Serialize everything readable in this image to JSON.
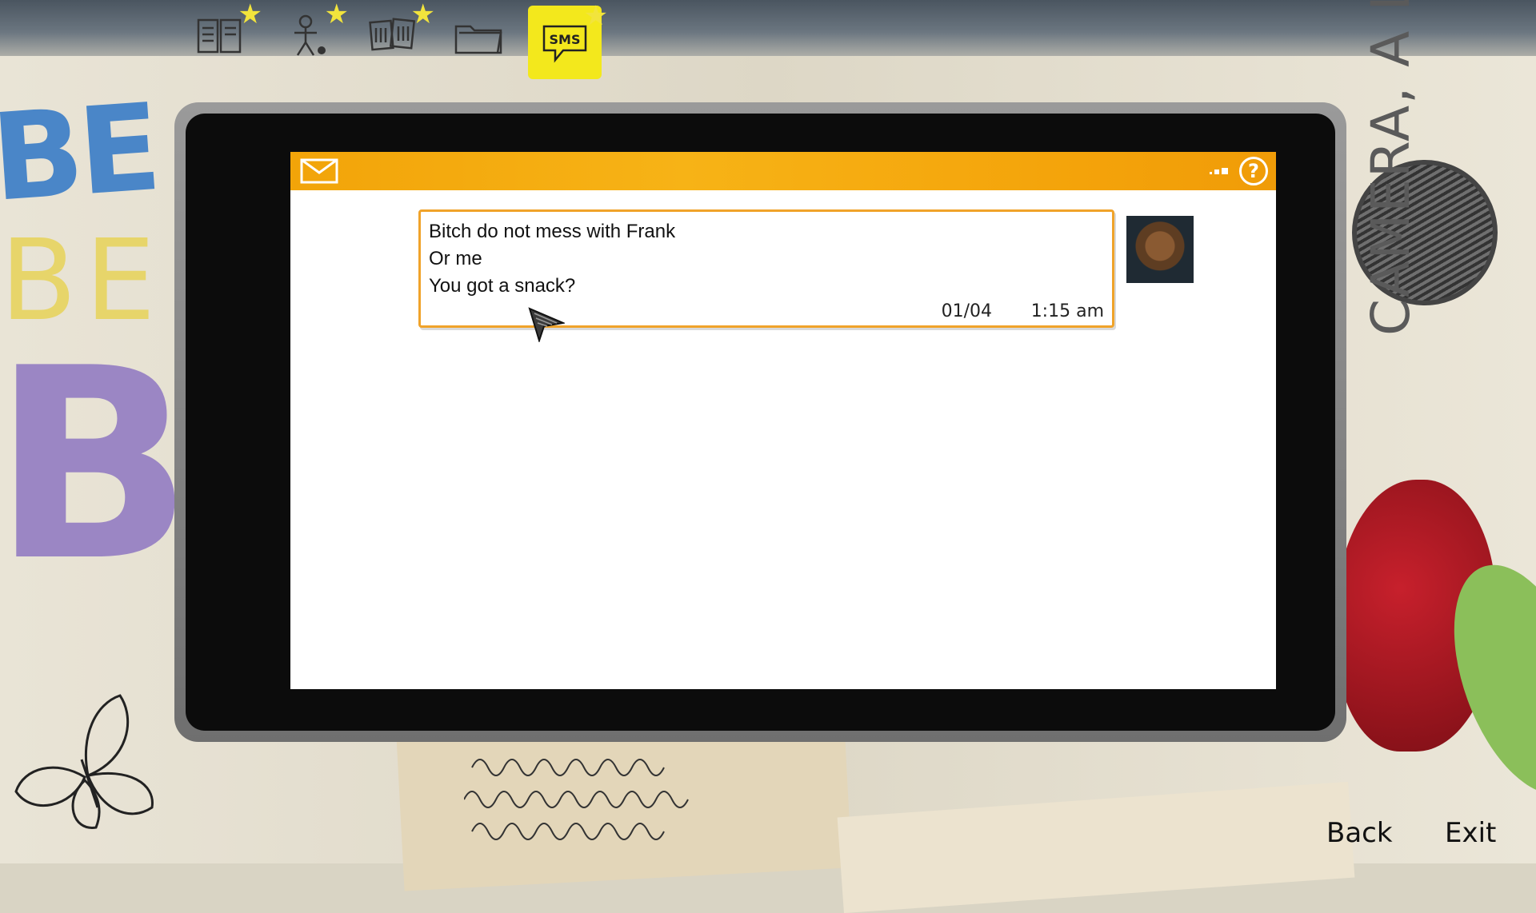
{
  "tabs": [
    {
      "name": "journal-tab",
      "icon": "journal-icon",
      "has_star": true
    },
    {
      "name": "characters-tab",
      "icon": "character-icon",
      "has_star": true
    },
    {
      "name": "photos-tab",
      "icon": "photos-icon",
      "has_star": true
    },
    {
      "name": "files-tab",
      "icon": "folder-icon",
      "has_star": false
    },
    {
      "name": "sms-tab",
      "icon": "sms-icon",
      "label": "SMS",
      "has_star": true,
      "active": true
    }
  ],
  "background": {
    "deco_1": "BE",
    "deco_2": "BE",
    "deco_3": "BI",
    "deco_right": "CAMERA, A LIAR, A MAGICIAN"
  },
  "phone": {
    "header_icon": "mail-icon",
    "help_label": "?",
    "message": {
      "lines": [
        "Bitch do not mess with Frank",
        "Or me",
        "You got a snack?"
      ],
      "date": "01/04",
      "time": "1:15 am",
      "avatar": "dog-avatar"
    }
  },
  "footer": {
    "back_label": "Back",
    "exit_label": "Exit"
  },
  "colors": {
    "header_orange": "#f2a409",
    "active_tab": "#f3e81c",
    "message_border": "#f0a32a"
  }
}
